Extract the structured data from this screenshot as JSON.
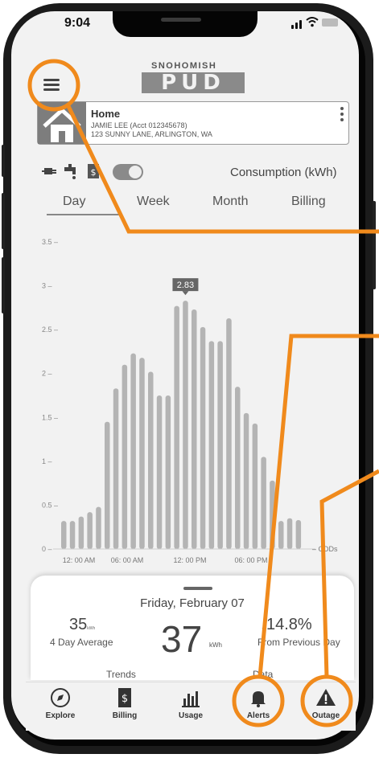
{
  "status_bar": {
    "time": "9:04"
  },
  "logo": {
    "top": "SNOHOMISH",
    "main": "PUD"
  },
  "account": {
    "name": "Home",
    "holder": "JAMIE LEE (Acct 012345678)",
    "address": "123 SUNNY LANE, ARLINGTON, WA"
  },
  "consumption_label": "Consumption (kWh)",
  "tabs": [
    "Day",
    "Week",
    "Month",
    "Billing"
  ],
  "chart_data": {
    "type": "bar",
    "y_ticks": [
      "3.5 –",
      "3 –",
      "2.5 –",
      "2 –",
      "1.5 –",
      "1 –",
      "0.5 –",
      "0 –"
    ],
    "x_ticks": [
      "12: 00 AM",
      "06: 00 AM",
      "12: 00 PM",
      "06: 00 PM"
    ],
    "ylim": [
      0,
      3.5
    ],
    "values": [
      0.32,
      0.32,
      0.37,
      0.42,
      0.48,
      1.45,
      1.83,
      2.1,
      2.23,
      2.18,
      2.02,
      1.75,
      1.75,
      2.77,
      2.83,
      2.73,
      2.53,
      2.37,
      2.37,
      2.63,
      1.85,
      1.55,
      1.43,
      1.05,
      0.78,
      0.32,
      0.35,
      0.33
    ],
    "highlight_value": "2.83",
    "secondary_label": "– CDDs",
    "grid": false
  },
  "summary": {
    "date": "Friday, February 07",
    "avg_value": "35",
    "avg_unit": "kWh",
    "avg_label": "4 Day Average",
    "main_value": "37",
    "main_unit": "kWh",
    "change_value": "14.8%",
    "change_label": "From Previous Day",
    "section_left": "Trends",
    "section_right": "Data"
  },
  "nav": {
    "explore": "Explore",
    "billing": "Billing",
    "usage": "Usage",
    "alerts": "Alerts",
    "outage": "Outage"
  },
  "colors": {
    "accent_orange": "#f08a1c",
    "bar_gray": "#b4b4b4",
    "text_dark": "#444444"
  }
}
